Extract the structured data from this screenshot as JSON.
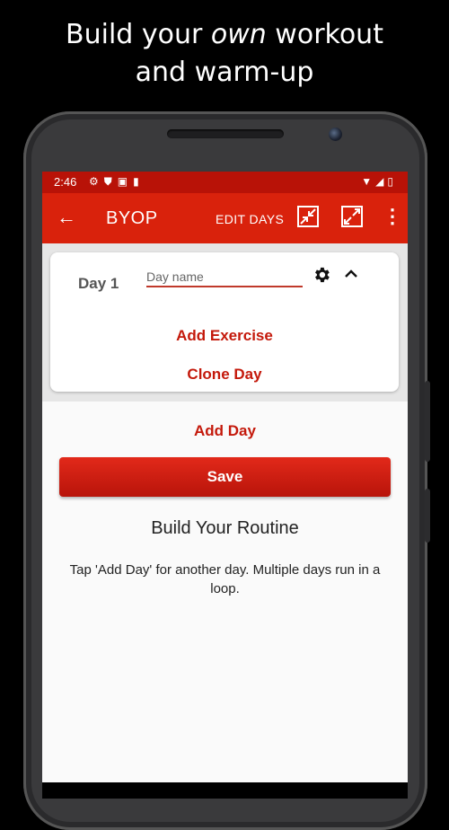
{
  "promo": {
    "line1_pre": "Build your ",
    "line1_em": "own",
    "line1_post": " workout",
    "line2": "and warm-up"
  },
  "status_bar": {
    "time": "2:46",
    "left_icons": [
      "gear-icon",
      "shield-icon",
      "a-icon",
      "sd-card-icon"
    ],
    "right_icons": [
      "wifi-icon",
      "signal-icon",
      "battery-icon"
    ]
  },
  "toolbar": {
    "title": "BYOP",
    "edit_days_label": "EDIT DAYS",
    "back_glyph": "←",
    "more_glyph": "⋮",
    "icons": [
      "collapse-all-icon",
      "expand-all-icon"
    ]
  },
  "day_card": {
    "day_label": "Day 1",
    "day_name_placeholder": "Day name",
    "day_name_value": "",
    "add_exercise_label": "Add Exercise",
    "clone_day_label": "Clone Day"
  },
  "main": {
    "add_day_label": "Add Day",
    "save_label": "Save",
    "routine_title": "Build Your Routine",
    "routine_help": "Tap 'Add Day' for another day. Multiple days run in a loop."
  },
  "colors": {
    "status_bar": "#b81207",
    "toolbar": "#d9220c",
    "accent_text": "#c4190b",
    "card_area": "#e6e6e6"
  }
}
